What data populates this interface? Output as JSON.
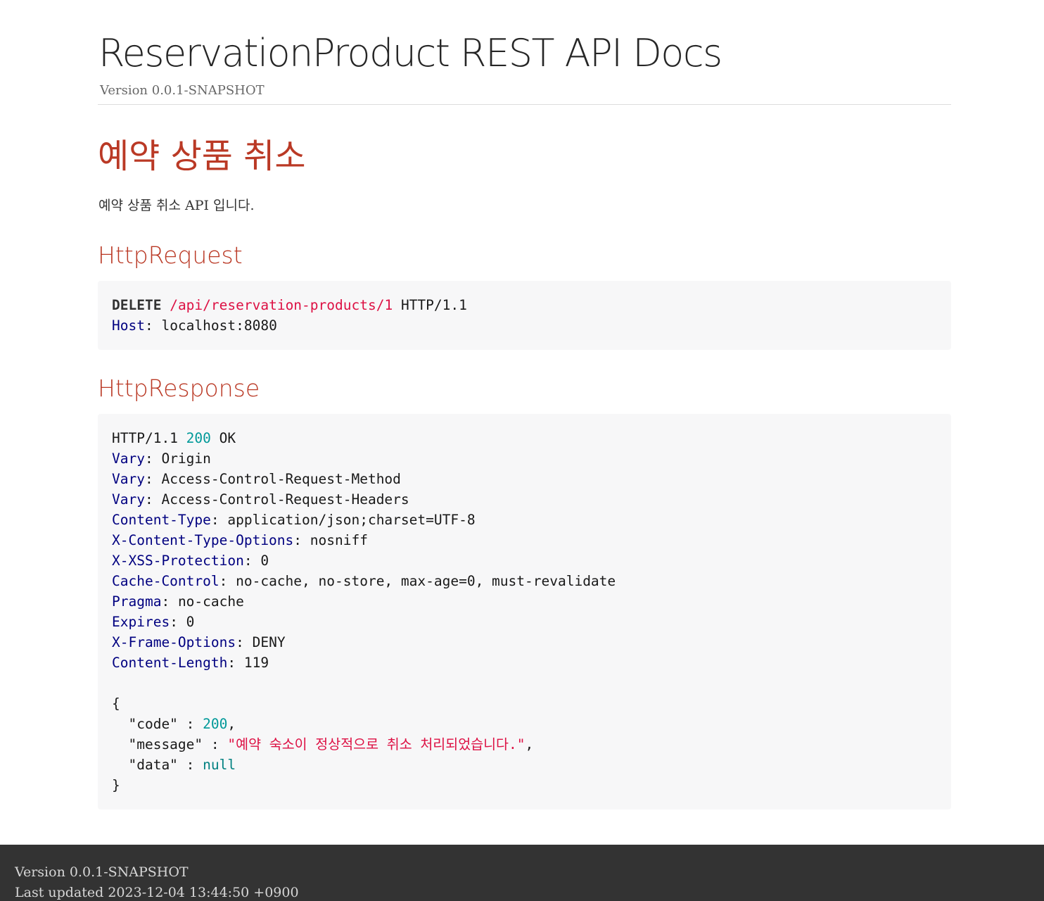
{
  "header": {
    "title": "ReservationProduct REST API Docs",
    "revnumber": "Version 0.0.1-SNAPSHOT"
  },
  "section": {
    "title": "예약 상품 취소",
    "description": "예약 상품 취소 API 입니다."
  },
  "request": {
    "title": "HttpRequest",
    "method": "DELETE",
    "path": "/api/reservation-products/1",
    "protocol": "HTTP/1.1",
    "headers": [
      {
        "name": "Host",
        "value": "localhost:8080"
      }
    ]
  },
  "response": {
    "title": "HttpResponse",
    "protocol": "HTTP/1.1",
    "status_code": "200",
    "status_text": "OK",
    "headers": [
      {
        "name": "Vary",
        "value": "Origin"
      },
      {
        "name": "Vary",
        "value": "Access-Control-Request-Method"
      },
      {
        "name": "Vary",
        "value": "Access-Control-Request-Headers"
      },
      {
        "name": "Content-Type",
        "value": "application/json;charset=UTF-8"
      },
      {
        "name": "X-Content-Type-Options",
        "value": "nosniff"
      },
      {
        "name": "X-XSS-Protection",
        "value": "0"
      },
      {
        "name": "Cache-Control",
        "value": "no-cache, no-store, max-age=0, must-revalidate"
      },
      {
        "name": "Pragma",
        "value": "no-cache"
      },
      {
        "name": "Expires",
        "value": "0"
      },
      {
        "name": "X-Frame-Options",
        "value": "DENY"
      },
      {
        "name": "Content-Length",
        "value": "119"
      }
    ],
    "body": {
      "code_key": "\"code\"",
      "code_value": "200",
      "message_key": "\"message\"",
      "message_value": "\"예약 숙소이 정상적으로 취소 처리되었습니다.\"",
      "data_key": "\"data\"",
      "data_value": "null"
    }
  },
  "footer": {
    "version": "Version 0.0.1-SNAPSHOT",
    "last_updated": "Last updated 2023-12-04 13:44:50 +0900"
  },
  "colors": {
    "section_title": "#ba3925",
    "code_background": "#f7f7f8",
    "footer_background": "#333333"
  }
}
